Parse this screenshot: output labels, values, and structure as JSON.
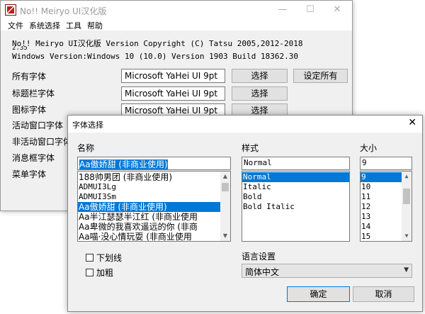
{
  "main_window": {
    "title": "No!! Meiryo UI汉化版",
    "menu": [
      "文件",
      "系统选择",
      "工具",
      "帮助"
    ],
    "version_line": "No!! Meiryo UI汉化版 Version  Copyright (C) Tatsu 2005,2012-2018",
    "version_line_2": "2.35",
    "os_line": "Windows Version:Windows 10 (10.0) Version 1903 Build 18362.30",
    "font_rows": [
      {
        "label": "所有字体",
        "value": "Microsoft YaHei UI  9pt",
        "button": "选择"
      },
      {
        "label": "标题栏字体",
        "value": "Microsoft YaHei UI  9pt",
        "button": "选择"
      },
      {
        "label": "图标字体",
        "value": "Microsoft YaHei UI  9pt",
        "button": "选择"
      },
      {
        "label": "活动窗口字体"
      },
      {
        "label": "非活动窗口字体"
      },
      {
        "label": "消息框字体"
      },
      {
        "label": "菜单字体"
      }
    ],
    "set_all_button": "设定所有"
  },
  "dialog": {
    "title": "字体选择",
    "name_label": "名称",
    "name_value": "Aa傲娇甜 (非商业使用)",
    "font_list": [
      "188帅男团 (非商业使用)",
      "ADMUI3Lg",
      "ADMUI3Sm",
      "Aa傲娇甜 (非商业使用)",
      "Aa半江瑟瑟半江红 (非商业使用",
      "Aa卑微的我喜欢遥远的你 (非商",
      "Aa喵·没心情玩耍 (非商业使用"
    ],
    "font_list_selected": 3,
    "style_label": "样式",
    "style_value": "Normal",
    "style_list": [
      "Normal",
      "Italic",
      "Bold",
      "Bold Italic"
    ],
    "style_list_selected": 0,
    "size_label": "大小",
    "size_value": "9",
    "size_list": [
      "9",
      "10",
      "11",
      "12",
      "13",
      "14",
      "15"
    ],
    "size_list_selected": 0,
    "underline_label": "下划线",
    "bold_label": "加粗",
    "language_label": "语言设置",
    "language_value": "简体中文",
    "ok_button": "确定",
    "cancel_button": "取消"
  },
  "colors": {
    "selection": "#0078d7",
    "window_bg": "#f0f0f0"
  }
}
